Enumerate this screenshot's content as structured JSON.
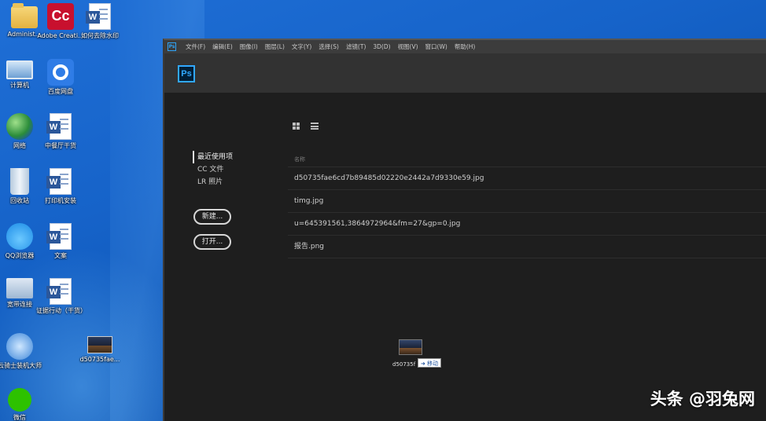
{
  "desktop": {
    "icons": [
      {
        "label": "Administ...",
        "icon": "folder-icon"
      },
      {
        "label": "Adobe Creati...",
        "icon": "adobe-creative-cloud-icon"
      },
      {
        "label": "如何去除水印",
        "icon": "word-doc-icon"
      },
      {
        "label": "计算机",
        "icon": "computer-icon"
      },
      {
        "label": "百度网盘",
        "icon": "baidu-netdisk-icon"
      },
      {
        "label": "网络",
        "icon": "network-icon"
      },
      {
        "label": "中餐厅干货",
        "icon": "word-doc-icon"
      },
      {
        "label": "回收站",
        "icon": "recycle-bin-icon"
      },
      {
        "label": "打印机安装",
        "icon": "word-doc-icon"
      },
      {
        "label": "QQ浏览器",
        "icon": "qq-browser-icon"
      },
      {
        "label": "文案",
        "icon": "word-doc-icon"
      },
      {
        "label": "宽带连接",
        "icon": "broadband-connection-icon"
      },
      {
        "label": "证据行动（干货）",
        "icon": "word-doc-icon"
      },
      {
        "label": "云骑士装机大师",
        "icon": "installer-globe-icon"
      },
      {
        "label": "d50735fae...",
        "icon": "image-file-icon"
      },
      {
        "label": "微信",
        "icon": "wechat-icon"
      }
    ],
    "watermark": "头条 @羽兔网"
  },
  "photoshop": {
    "logo_small": "Ps",
    "logo": "Ps",
    "menu": [
      "文件(F)",
      "编辑(E)",
      "图像(I)",
      "图层(L)",
      "文字(Y)",
      "选择(S)",
      "滤镜(T)",
      "3D(D)",
      "视图(V)",
      "窗口(W)",
      "帮助(H)"
    ],
    "sidebar": {
      "items": [
        "最近使用项",
        "CC 文件",
        "LR 照片"
      ],
      "active": "最近使用项"
    },
    "buttons": {
      "new": "新建...",
      "open": "打开..."
    },
    "file_list": {
      "header": "名称",
      "files": [
        "d50735fae6cd7b89485d02220e2442a7d9330e59.jpg",
        "timg.jpg",
        "u=645391561,3864972964&fm=27&gp=0.jpg",
        "报告.png"
      ]
    },
    "drag": {
      "filename": "d50735f",
      "tooltip": "➜ 移动"
    }
  }
}
